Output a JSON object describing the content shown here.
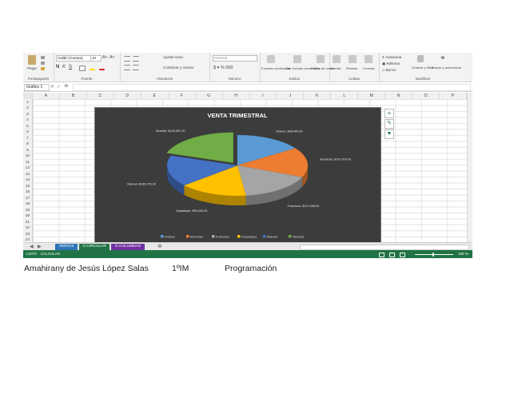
{
  "ribbon": {
    "paste_label": "Pegar",
    "font_name": "Calibri (Cuerpo)",
    "font_size": "10",
    "wrap_text": "Ajustar texto",
    "merge_center": "Combinar y centrar",
    "number_format": "General",
    "cond_format": "Formato condicional",
    "format_table": "Dar formato como tabla",
    "cell_styles": "Estilos de celda",
    "insert": "Insertar",
    "delete": "Eliminar",
    "format": "Formato",
    "autosum": "Autosuma",
    "fill": "Rellenar",
    "clear": "Borrar",
    "sort_filter": "Ordenar y filtrar",
    "find_select": "Buscar y seleccionar",
    "group_clipboard": "Portapapeles",
    "group_font": "Fuente",
    "group_alignment": "Alineación",
    "group_number": "Número",
    "group_styles": "Estilos",
    "group_cells": "Celdas",
    "group_editing": "Modificar"
  },
  "formula_bar": {
    "name_box": "Gráfico 1",
    "fx": "fx"
  },
  "columns": [
    "A",
    "B",
    "C",
    "D",
    "E",
    "F",
    "G",
    "H",
    "I",
    "J",
    "K",
    "L",
    "M",
    "N",
    "O",
    "P"
  ],
  "rows": [
    "1",
    "2",
    "3",
    "4",
    "5",
    "6",
    "7",
    "8",
    "9",
    "10",
    "11",
    "12",
    "13",
    "14",
    "15",
    "16",
    "17",
    "18",
    "19",
    "20",
    "21",
    "22",
    "23",
    "24"
  ],
  "chart_data": {
    "type": "pie",
    "title": "VENTA TRIMESTRAL",
    "categories": [
      "Andres",
      "Bernardo",
      "Francisco",
      "Guadalupe",
      "Manuel",
      "Nereida"
    ],
    "values": [
      98400,
      101414,
      107038,
      99432,
      105795,
      126057.2
    ],
    "labels": [
      "Andres, $98,400.00",
      "Bernardo, $101,414.00",
      "Francisco, $107,038.00",
      "Guadalupe, $99,432.00",
      "Manuel, $105,795.00",
      "Nereida, $126,057.20"
    ],
    "colors": [
      "#5b9bd5",
      "#ed7d31",
      "#a5a5a5",
      "#ffc000",
      "#4472c4",
      "#70ad47"
    ],
    "legend": "bottom"
  },
  "tabs": [
    {
      "label": "VENTAS",
      "color": "#2e75b6"
    },
    {
      "label": "G.CIRCULAR",
      "color": "#217346"
    },
    {
      "label": "G.COLUMNAS",
      "color": "#7030a0"
    }
  ],
  "status": {
    "mode": "LISTO",
    "calc": "CALCULAR",
    "zoom": "100 %"
  },
  "caption": {
    "author": "Amahirany de Jesús López Salas",
    "group": "1ºIM",
    "subject": "Programación"
  }
}
